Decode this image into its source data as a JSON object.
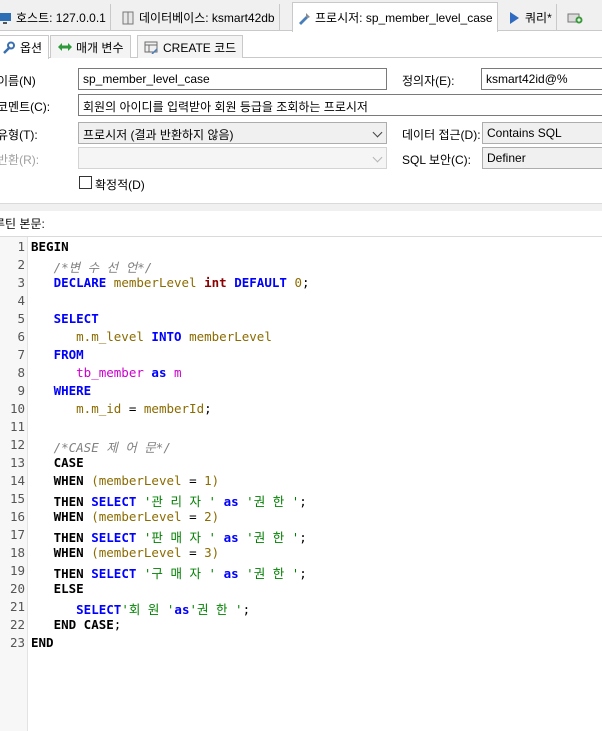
{
  "tabs": [
    {
      "label": "호스트: 127.0.0.1",
      "icon": "host-icon"
    },
    {
      "label": "데이터베이스: ksmart42db",
      "icon": "database-icon"
    },
    {
      "label": "프로시저: sp_member_level_case",
      "icon": "procedure-icon"
    },
    {
      "label": "쿼리*",
      "icon": "play-icon"
    },
    {
      "label": "",
      "icon": "new-tab-icon"
    }
  ],
  "subtabs": [
    {
      "label": "옵션",
      "icon": "wrench-icon"
    },
    {
      "label": "매개 변수",
      "icon": "arrows-icon"
    },
    {
      "label": "CREATE 코드",
      "icon": "table-icon"
    }
  ],
  "form": {
    "name_label": "이름(N)",
    "name_value": "sp_member_level_case",
    "definer_label": "정의자(E):",
    "definer_value": "ksmart42id@%",
    "comment_label": "코멘트(C):",
    "comment_value": "회원의 아이디를 입력받아 회원 등급을 조회하는 프로시저",
    "type_label": "유형(T):",
    "type_value": "프로시저 (결과 반환하지 않음)",
    "data_access_label": "데이터 접근(D):",
    "data_access_value": "Contains SQL",
    "return_label": "반환(R):",
    "return_value": "",
    "sql_security_label": "SQL 보안(C):",
    "sql_security_value": "Definer",
    "deterministic_label": "확정적(D)",
    "deterministic_checked": false
  },
  "body_label": "루틴 본문:",
  "code": {
    "line_numbers": [
      "1",
      "2",
      "3",
      "4",
      "5",
      "6",
      "7",
      "8",
      "9",
      "10",
      "11",
      "12",
      "13",
      "14",
      "15",
      "16",
      "17",
      "18",
      "19",
      "20",
      "21",
      "22",
      "23"
    ],
    "t": {
      "begin": "BEGIN",
      "c1": "/*변 수 선 언*/",
      "declare": "DECLARE",
      "memberLevel": "memberLevel",
      "int": "int",
      "default": "DEFAULT",
      "zero": "0",
      "semi": ";",
      "select": "SELECT",
      "m_level": "m.m_level",
      "into": "INTO",
      "from": "FROM",
      "tb_member": "tb_member",
      "as": "as",
      "m": "m",
      "where": "WHERE",
      "m_id": "m.m_id",
      "eq": "=",
      "memberId": "memberId",
      "c2": "/*CASE 제 어 문*/",
      "case": "CASE",
      "when": "WHEN",
      "lp": "(",
      "rp": ")",
      "one": "1",
      "two": "2",
      "three": "3",
      "then": "THEN",
      "s_admin": "'관 리 자 '",
      "s_seller": "'판 매 자 '",
      "s_buyer": "'구 매 자 '",
      "s_auth": "'권 한 '",
      "s_member": "'회 원 '",
      "s_auth2": "'권 한 '",
      "as_q": "as",
      "else": "ELSE",
      "end_case": "END CASE",
      "end": "END"
    }
  }
}
